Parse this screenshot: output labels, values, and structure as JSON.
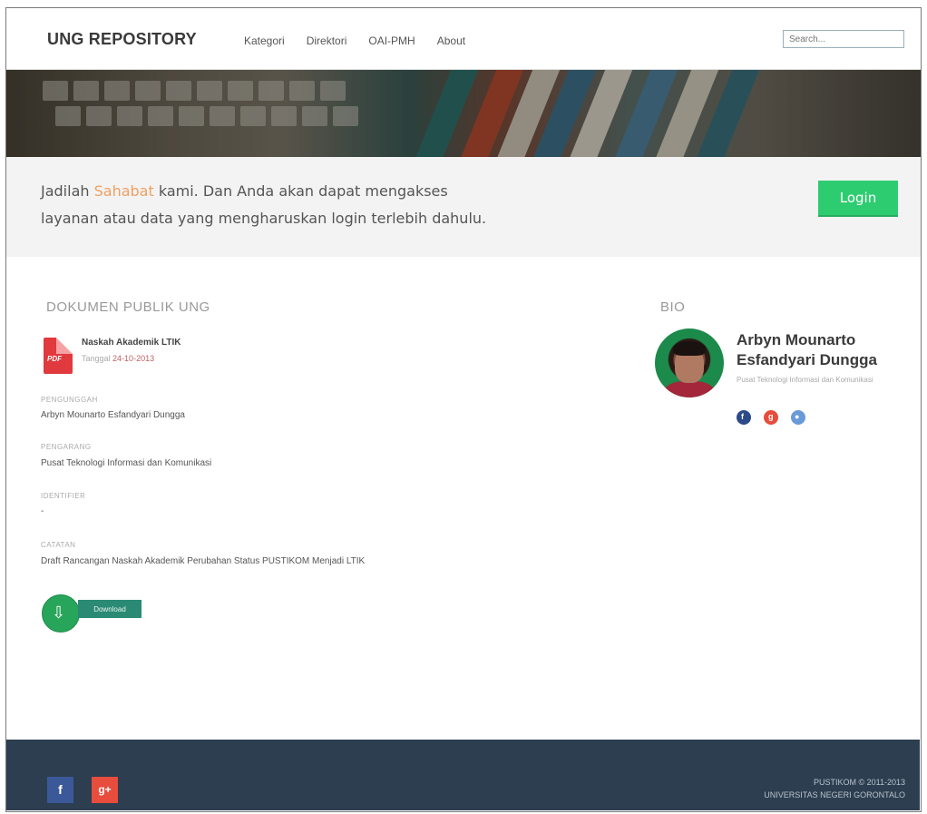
{
  "navbar": {
    "brand": "UNG REPOSITORY",
    "links": [
      "Kategori",
      "Direktori",
      "OAI-PMH",
      "About"
    ],
    "search_placeholder": "Search..."
  },
  "band": {
    "line1_pre": "Jadilah ",
    "line1_highlight": "Sahabat",
    "line1_post": " kami. Dan Anda akan dapat mengakses",
    "line2": "layanan atau data yang mengharuskan login terlebih dahulu.",
    "login_label": "Login",
    "accent_color": "#f0a060",
    "button_color": "#2ecc71"
  },
  "document": {
    "section_title": "DOKUMEN PUBLIK UNG",
    "file_icon": "pdf-icon",
    "file_type": "PDF",
    "title": "Naskah Akademik LTIK",
    "date_label": "Tanggal",
    "date": "24-10-2013",
    "fields": [
      {
        "label": "PENGUNGGAH",
        "value": "Arbyn Mounarto Esfandyari Dungga"
      },
      {
        "label": "PENGARANG",
        "value": "Pusat Teknologi Informasi dan Komunikasi"
      },
      {
        "label": "IDENTIFIER",
        "value": "-"
      },
      {
        "label": "CATATAN",
        "value": "Draft Rancangan Naskah Akademik Perubahan Status PUSTIKOM Menjadi LTIK"
      }
    ],
    "download_label": "Download",
    "download_icon": "download-icon"
  },
  "bio": {
    "section_title": "BIO",
    "name_line1": "Arbyn Mounarto",
    "name_line2": "Esfandyari Dungga",
    "org": "Pusat Teknologi Informasi dan Komunikasi",
    "social": [
      {
        "icon": "facebook-icon",
        "glyph": "f",
        "color": "#2c4a8a"
      },
      {
        "icon": "google-plus-icon",
        "glyph": "g",
        "color": "#e74c3c"
      },
      {
        "icon": "user-icon",
        "glyph": "●",
        "color": "#6a9ad8"
      }
    ]
  },
  "footer": {
    "facebook_glyph": "f",
    "google_glyph": "g+",
    "copyright_line1": "PUSTIKOM © 2011-2013",
    "copyright_line2": "UNIVERSITAS NEGERI GORONTALO",
    "bg_color": "#2c3e50"
  }
}
